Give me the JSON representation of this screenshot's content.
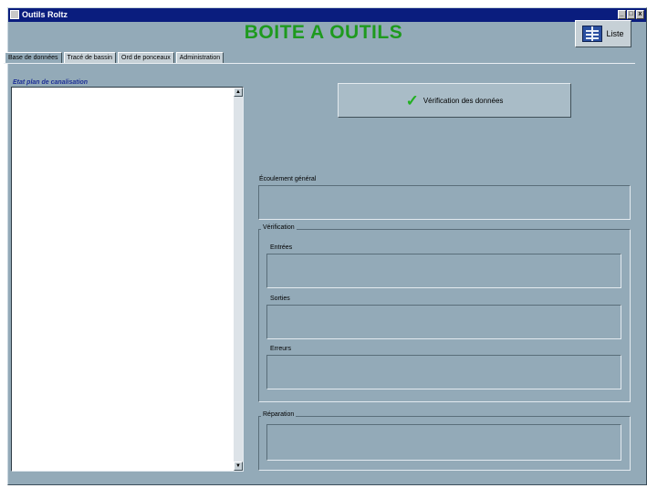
{
  "window": {
    "title": "Outils Roltz",
    "controls": {
      "min": "_",
      "max": "□",
      "close": "x"
    }
  },
  "header": {
    "title": "BOITE A OUTILS",
    "list_button_label": "Liste"
  },
  "tabs": [
    {
      "label": "Base de données",
      "active": true
    },
    {
      "label": "Tracé de bassin"
    },
    {
      "label": "Ord de ponceaux"
    },
    {
      "label": "Administration"
    }
  ],
  "list": {
    "label": "Etat plan de canalisation",
    "items": []
  },
  "actions": {
    "verify_label": "Vérification des données"
  },
  "fields": {
    "general_label": "Écoulement général",
    "verification_group_title": "Vérification",
    "entrees_label": "Entrées",
    "sorties_label": "Sorties",
    "erreurs_label": "Erreurs",
    "reparation_group_title": "Réparation"
  },
  "colors": {
    "accent_title": "#1e9a1e",
    "window_bg": "#93aab8",
    "titlebar": "#0a1d7e"
  }
}
